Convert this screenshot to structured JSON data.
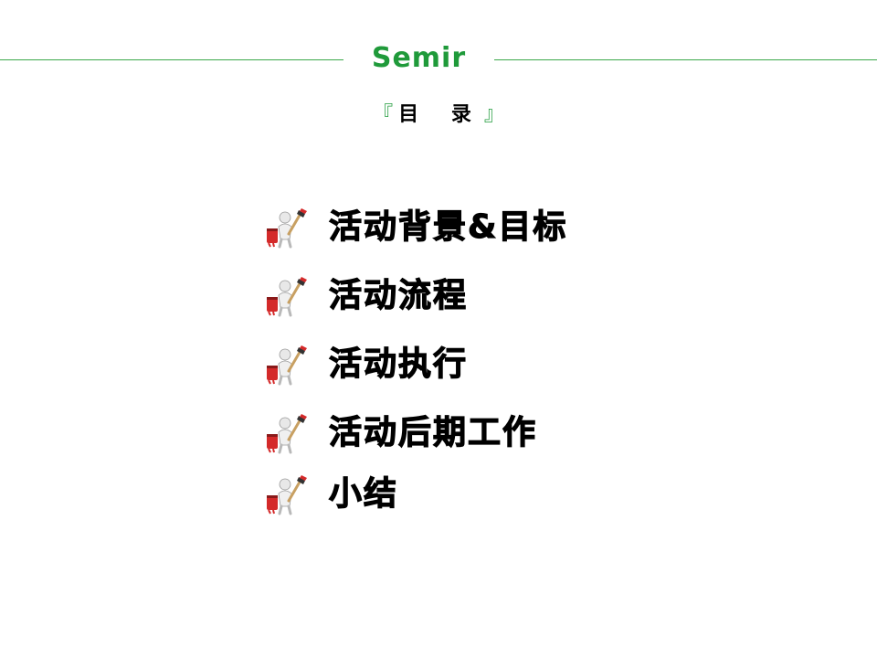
{
  "header": {
    "brand": "Semir",
    "brand_color": "#1f9a3a",
    "line_color": "#3aa84a"
  },
  "toc": {
    "bracket_open": "『",
    "title": "目 录",
    "bracket_close": "』"
  },
  "menu": {
    "icon": "painter-figure-brush-icon",
    "items": [
      {
        "label": "活动背景&目标"
      },
      {
        "label": "活动流程"
      },
      {
        "label": "活动执行"
      },
      {
        "label": "活动后期工作"
      },
      {
        "label": "小结"
      }
    ]
  }
}
